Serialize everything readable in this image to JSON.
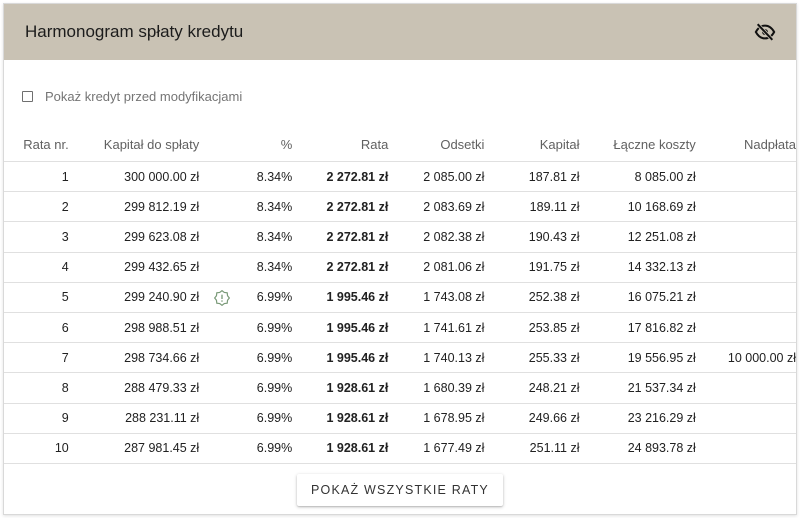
{
  "header": {
    "title": "Harmonogram spłaty kredytu",
    "toggle_icon": "eye-off-icon"
  },
  "options": {
    "show_before_modifications_label": "Pokaż kredyt przed modyfikacjami",
    "show_before_modifications_checked": false
  },
  "table": {
    "columns": [
      "Rata nr.",
      "Kapitał do spłaty",
      "%",
      "Rata",
      "Odsetki",
      "Kapitał",
      "Łączne koszty",
      "Nadpłata"
    ],
    "rows": [
      {
        "nr": "1",
        "kapital_do_splaty": "300 000.00 zł",
        "procent": "8.34%",
        "rata": "2 272.81 zł",
        "odsetki": "2 085.00 zł",
        "kapital": "187.81 zł",
        "laczne_koszty": "8 085.00 zł",
        "nadplata": ""
      },
      {
        "nr": "2",
        "kapital_do_splaty": "299 812.19 zł",
        "procent": "8.34%",
        "rata": "2 272.81 zł",
        "odsetki": "2 083.69 zł",
        "kapital": "189.11 zł",
        "laczne_koszty": "10 168.69 zł",
        "nadplata": ""
      },
      {
        "nr": "3",
        "kapital_do_splaty": "299 623.08 zł",
        "procent": "8.34%",
        "rata": "2 272.81 zł",
        "odsetki": "2 082.38 zł",
        "kapital": "190.43 zł",
        "laczne_koszty": "12 251.08 zł",
        "nadplata": ""
      },
      {
        "nr": "4",
        "kapital_do_splaty": "299 432.65 zł",
        "procent": "8.34%",
        "rata": "2 272.81 zł",
        "odsetki": "2 081.06 zł",
        "kapital": "191.75 zł",
        "laczne_koszty": "14 332.13 zł",
        "nadplata": ""
      },
      {
        "nr": "5",
        "kapital_do_splaty": "299 240.90 zł",
        "procent": "6.99%",
        "rata": "1 995.46 zł",
        "odsetki": "1 743.08 zł",
        "kapital": "252.38 zł",
        "laczne_koszty": "16 075.21 zł",
        "nadplata": "",
        "rate_change_icon": true
      },
      {
        "nr": "6",
        "kapital_do_splaty": "298 988.51 zł",
        "procent": "6.99%",
        "rata": "1 995.46 zł",
        "odsetki": "1 741.61 zł",
        "kapital": "253.85 zł",
        "laczne_koszty": "17 816.82 zł",
        "nadplata": ""
      },
      {
        "nr": "7",
        "kapital_do_splaty": "298 734.66 zł",
        "procent": "6.99%",
        "rata": "1 995.46 zł",
        "odsetki": "1 740.13 zł",
        "kapital": "255.33 zł",
        "laczne_koszty": "19 556.95 zł",
        "nadplata": "10 000.00 zł"
      },
      {
        "nr": "8",
        "kapital_do_splaty": "288 479.33 zł",
        "procent": "6.99%",
        "rata": "1 928.61 zł",
        "odsetki": "1 680.39 zł",
        "kapital": "248.21 zł",
        "laczne_koszty": "21 537.34 zł",
        "nadplata": ""
      },
      {
        "nr": "9",
        "kapital_do_splaty": "288 231.11 zł",
        "procent": "6.99%",
        "rata": "1 928.61 zł",
        "odsetki": "1 678.95 zł",
        "kapital": "249.66 zł",
        "laczne_koszty": "23 216.29 zł",
        "nadplata": ""
      },
      {
        "nr": "10",
        "kapital_do_splaty": "287 981.45 zł",
        "procent": "6.99%",
        "rata": "1 928.61 zł",
        "odsetki": "1 677.49 zł",
        "kapital": "251.11 zł",
        "laczne_koszty": "24 893.78 zł",
        "nadplata": ""
      }
    ]
  },
  "footer": {
    "show_all_label": "POKAŻ WSZYSTKIE RATY"
  },
  "colors": {
    "header_bg": "#c9c2b4",
    "alert_icon": "#7a9a78"
  }
}
